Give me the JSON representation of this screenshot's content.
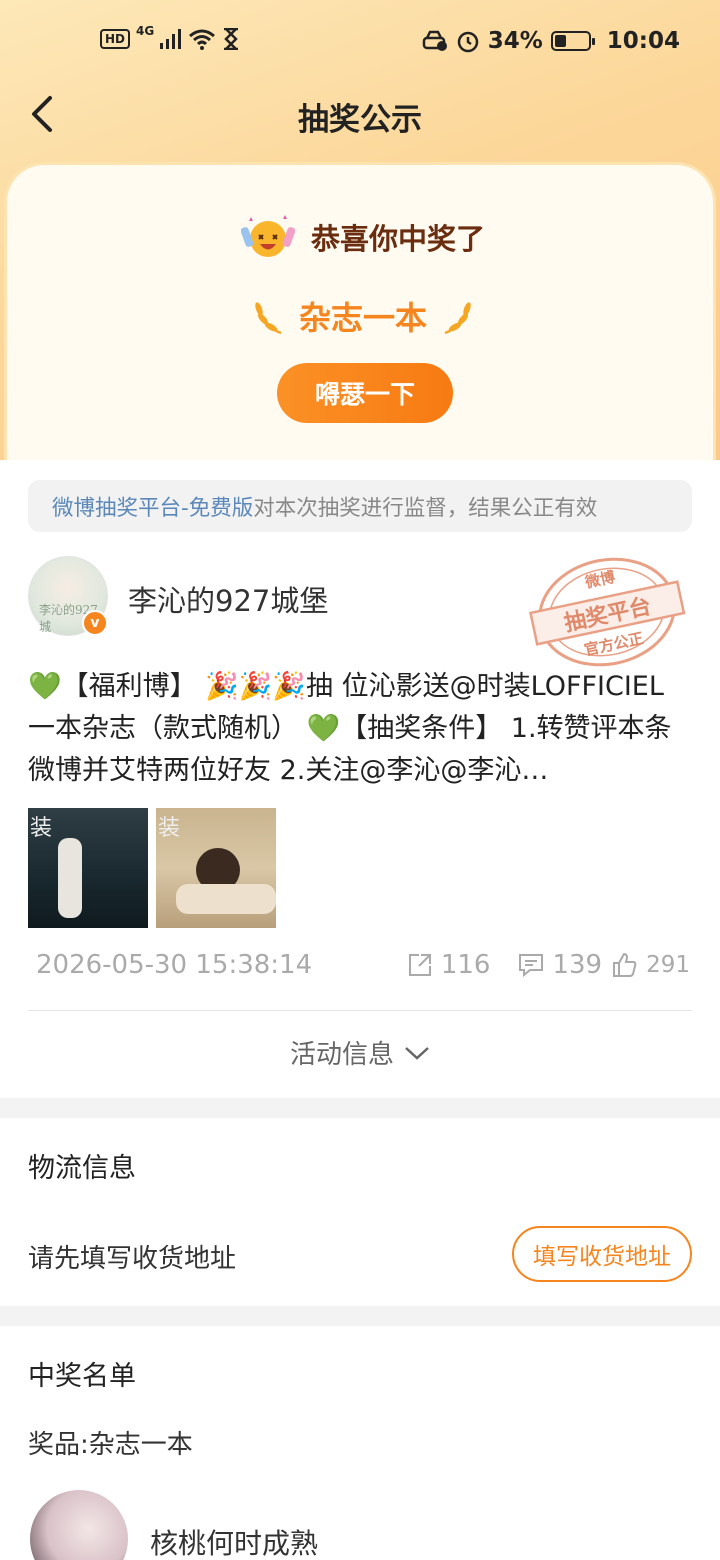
{
  "status_bar": {
    "hd": "HD",
    "net": "4G",
    "battery_pct": "34%",
    "battery_level": 0.34,
    "time": "10:04"
  },
  "nav": {
    "title": "抽奖公示"
  },
  "prize_card": {
    "congrats": "恭喜你中奖了",
    "prize": "杂志一本",
    "share_button": "嘚瑟一下"
  },
  "notice": {
    "platform": "微博抽奖平台-免费版",
    "text": " 对本次抽奖进行监督，结果公正有效"
  },
  "post": {
    "author": "李沁的927城堡",
    "verified_mark": "v",
    "avatar_text": "李沁的927城",
    "stamp": {
      "top": "微博",
      "middle": "抽奖平台",
      "bottom": "官方公正"
    },
    "text": "💚【福利博】 🎉🎉🎉抽 位沁影送@时装LOFFICIEL 一本杂志（款式随机） 💚【抽奖条件】 1.转赞评本条微博并艾特两位好友 2.关注@李沁@李沁…",
    "thumb_marks": [
      "装",
      "装"
    ],
    "date": "2026-05-30 15:38:14",
    "reposts": "116",
    "comments": "139",
    "likes": "291"
  },
  "activity_info_label": "活动信息",
  "logistics": {
    "title": "物流信息",
    "hint": "请先填写收货地址",
    "button": "填写收货地址"
  },
  "winners": {
    "title": "中奖名单",
    "prize_line": "奖品:杂志一本",
    "first_winner": "核桃何时成熟"
  },
  "colors": {
    "accent": "#f5851f",
    "link": "#5b88b8"
  }
}
